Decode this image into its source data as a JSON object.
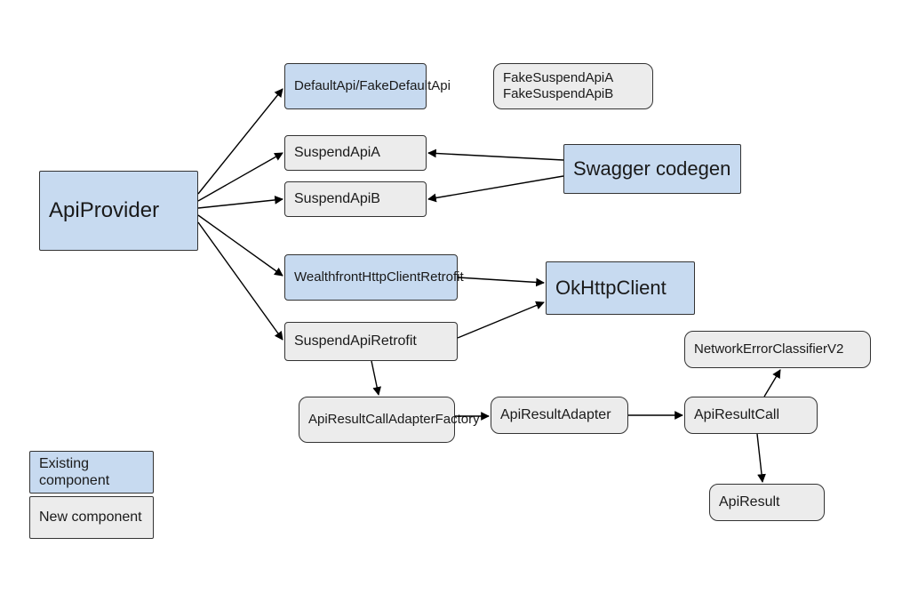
{
  "chart_data": {
    "type": "diagram",
    "title": "",
    "nodes": [
      {
        "id": "ApiProvider",
        "label": "ApiProvider",
        "category": "existing"
      },
      {
        "id": "DefaultApi",
        "label": "DefaultApi/FakeDefaultApi",
        "category": "existing"
      },
      {
        "id": "SuspendApiA",
        "label": "SuspendApiA",
        "category": "new"
      },
      {
        "id": "SuspendApiB",
        "label": "SuspendApiB",
        "category": "new"
      },
      {
        "id": "WealthfrontHttpClientRetrofit",
        "label": "WealthfrontHttpClientRetrofit",
        "category": "existing"
      },
      {
        "id": "SuspendApiRetrofit",
        "label": "SuspendApiRetrofit",
        "category": "new"
      },
      {
        "id": "FakeSuspendApis",
        "label": "FakeSuspendApiA\nFakeSuspendApiB",
        "category": "new"
      },
      {
        "id": "SwaggerCodegen",
        "label": "Swagger codegen",
        "category": "existing"
      },
      {
        "id": "OkHttpClient",
        "label": "OkHttpClient",
        "category": "existing"
      },
      {
        "id": "ApiResultCallAdapterFactory",
        "label": "ApiResultCallAdapterFactory",
        "category": "new"
      },
      {
        "id": "ApiResultAdapter",
        "label": "ApiResultAdapter",
        "category": "new"
      },
      {
        "id": "ApiResultCall",
        "label": "ApiResultCall",
        "category": "new"
      },
      {
        "id": "NetworkErrorClassifierV2",
        "label": "NetworkErrorClassifierV2",
        "category": "new"
      },
      {
        "id": "ApiResult",
        "label": "ApiResult",
        "category": "new"
      }
    ],
    "edges": [
      {
        "from": "ApiProvider",
        "to": "DefaultApi"
      },
      {
        "from": "ApiProvider",
        "to": "SuspendApiA"
      },
      {
        "from": "ApiProvider",
        "to": "SuspendApiB"
      },
      {
        "from": "ApiProvider",
        "to": "WealthfrontHttpClientRetrofit"
      },
      {
        "from": "ApiProvider",
        "to": "SuspendApiRetrofit"
      },
      {
        "from": "SwaggerCodegen",
        "to": "SuspendApiA"
      },
      {
        "from": "SwaggerCodegen",
        "to": "SuspendApiB"
      },
      {
        "from": "WealthfrontHttpClientRetrofit",
        "to": "OkHttpClient"
      },
      {
        "from": "SuspendApiRetrofit",
        "to": "OkHttpClient"
      },
      {
        "from": "SuspendApiRetrofit",
        "to": "ApiResultCallAdapterFactory"
      },
      {
        "from": "ApiResultCallAdapterFactory",
        "to": "ApiResultAdapter"
      },
      {
        "from": "ApiResultAdapter",
        "to": "ApiResultCall"
      },
      {
        "from": "ApiResultCall",
        "to": "NetworkErrorClassifierV2"
      },
      {
        "from": "ApiResultCall",
        "to": "ApiResult"
      }
    ],
    "legend": [
      {
        "label": "Existing component",
        "category": "existing"
      },
      {
        "label": "New component",
        "category": "new"
      }
    ]
  },
  "nodes": {
    "apiProvider": "ApiProvider",
    "defaultApi": "DefaultApi/FakeDefaultApi",
    "suspendApiA": "SuspendApiA",
    "suspendApiB": "SuspendApiB",
    "wfRetrofit": "WealthfrontHttpClientRetrofit",
    "suspendRetrofit": "SuspendApiRetrofit",
    "fakeA": "FakeSuspendApiA",
    "fakeB": "FakeSuspendApiB",
    "swagger": "Swagger codegen",
    "okHttp": "OkHttpClient",
    "arcFactory": "ApiResultCallAdapterFactory",
    "arAdapter": "ApiResultAdapter",
    "arCall": "ApiResultCall",
    "neClassifier": "NetworkErrorClassifierV2",
    "apiResult": "ApiResult"
  },
  "legend": {
    "existing": "Existing component",
    "new": "New component"
  }
}
